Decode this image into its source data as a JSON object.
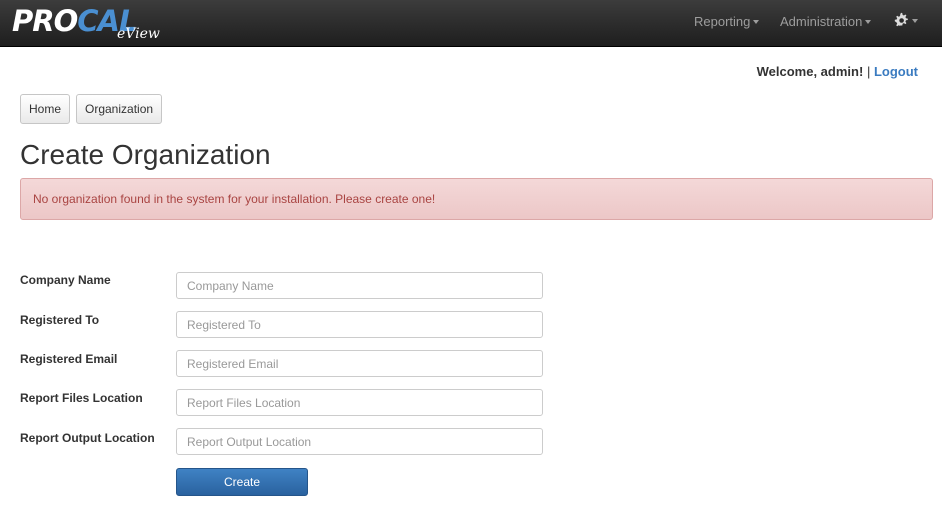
{
  "brand": {
    "pro": "PRO",
    "cal": "CAL",
    "sub": "eView"
  },
  "nav": {
    "reporting": "Reporting",
    "administration": "Administration",
    "settings_icon": "gear-icon"
  },
  "welcome": {
    "text": "Welcome, admin!",
    "separator": "|",
    "logout": "Logout"
  },
  "breadcrumb": [
    "Home",
    "Organization"
  ],
  "page_title": "Create Organization",
  "alert": "No organization found in the system for your installation. Please create one!",
  "form": {
    "fields": [
      {
        "label": "Company Name",
        "value": "",
        "placeholder": "Company Name"
      },
      {
        "label": "Registered To",
        "value": "",
        "placeholder": "Registered To"
      },
      {
        "label": "Registered Email",
        "value": "",
        "placeholder": "Registered Email"
      },
      {
        "label": "Report Files Location",
        "value": "",
        "placeholder": "Report Files Location"
      },
      {
        "label": "Report Output Location",
        "value": "",
        "placeholder": "Report Output Location"
      }
    ],
    "submit": "Create"
  },
  "colors": {
    "navbar": "#262626",
    "brand_accent": "#4a8fd1",
    "alert_bg": "#f2dede",
    "alert_text": "#a94442",
    "primary": "#2d6ca2",
    "link": "#3a7bc0"
  }
}
